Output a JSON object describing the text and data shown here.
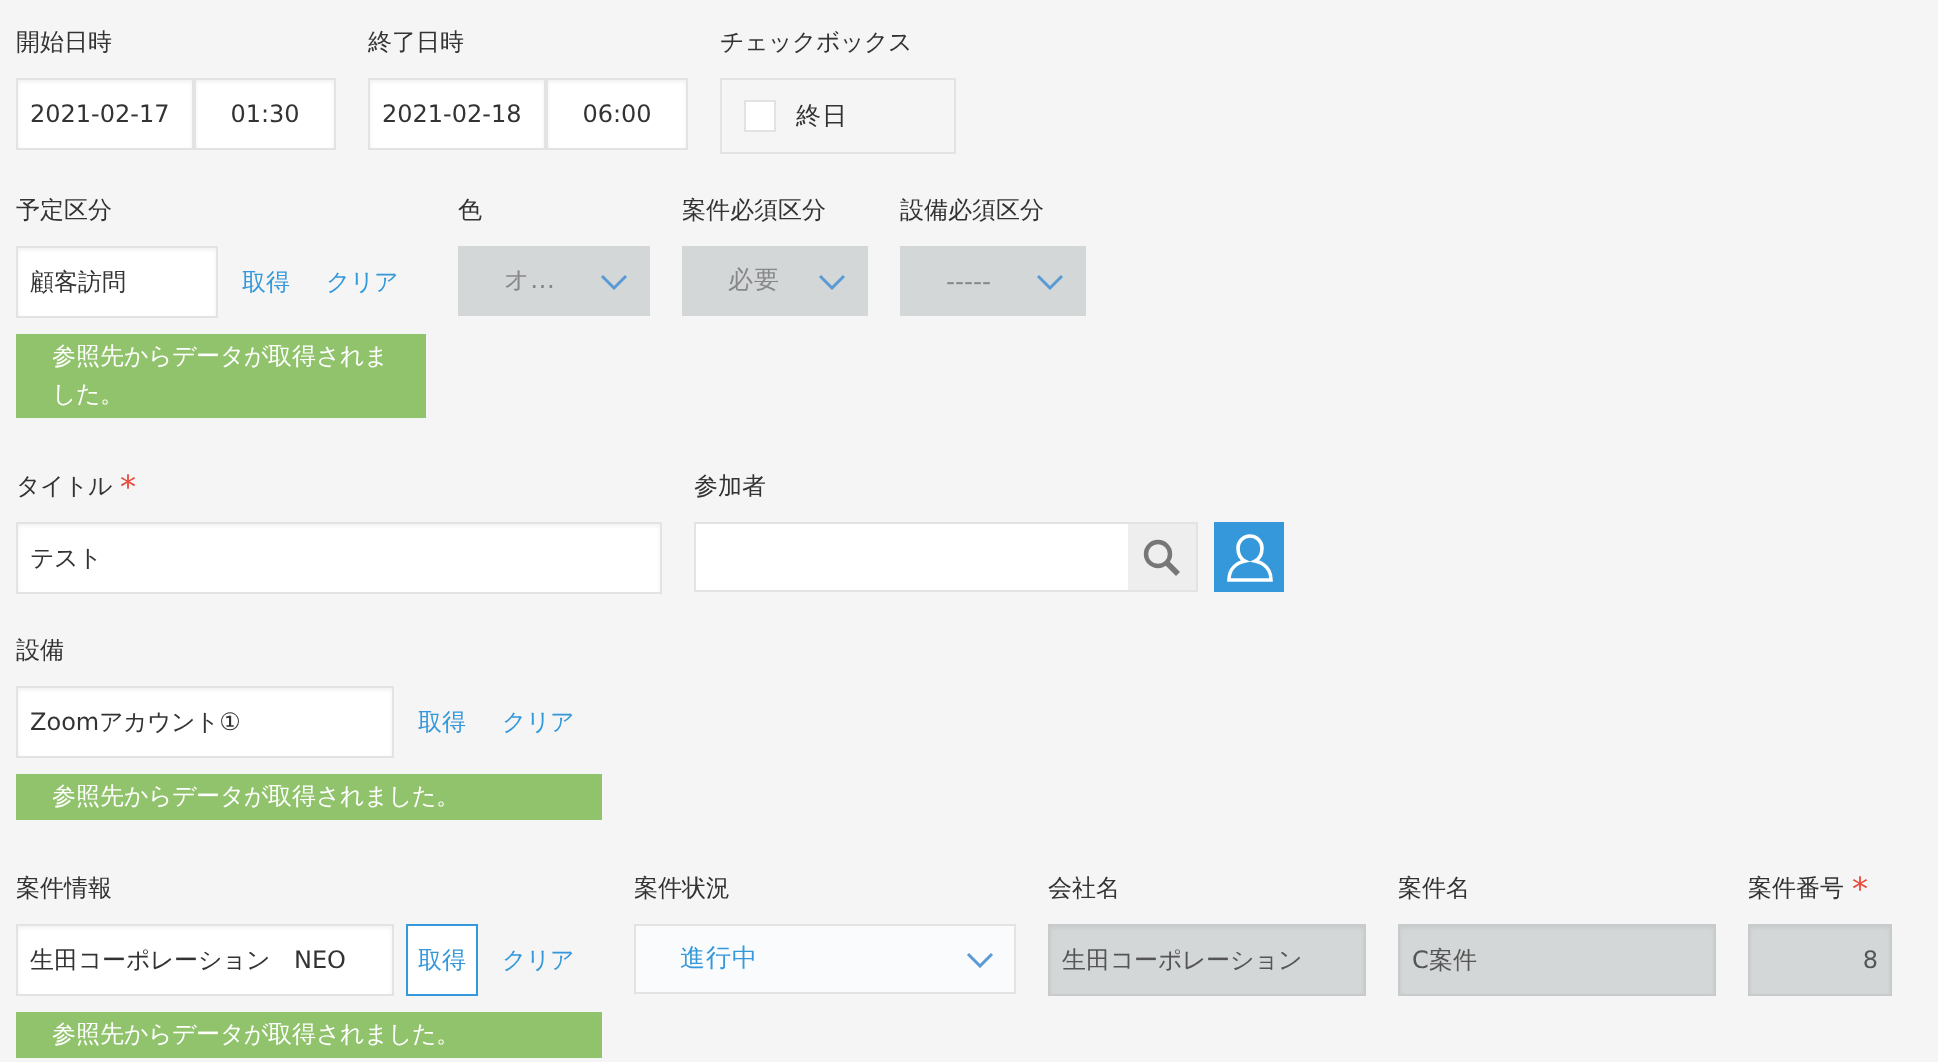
{
  "rows": [
    {
      "fields": [
        {
          "kind": "datetime",
          "label": "開始日時",
          "date": "2021-02-17",
          "time": "01:30"
        },
        {
          "kind": "datetime",
          "label": "終了日時",
          "date": "2021-02-18",
          "time": "06:00"
        },
        {
          "kind": "checkbox",
          "label": "チェックボックス",
          "options": [
            {
              "label": "終日",
              "checked": false
            }
          ]
        }
      ]
    },
    {
      "fields": [
        {
          "kind": "lookup",
          "label": "予定区分",
          "value": "顧客訪問",
          "get": "取得",
          "get_focused": false,
          "clear": "クリア",
          "message": "参照先からデータが取得されました。"
        },
        {
          "kind": "select",
          "label": "色",
          "value": "オ…",
          "disabled": true
        },
        {
          "kind": "select",
          "label": "案件必須区分",
          "value": "必要",
          "disabled": true
        },
        {
          "kind": "select",
          "label": "設備必須区分",
          "value": "-----",
          "disabled": true
        }
      ]
    },
    {
      "fields": [
        {
          "kind": "text",
          "label": "タイトル",
          "required_mark": "*",
          "value": "テスト",
          "disabled": false
        },
        {
          "kind": "user",
          "label": "参加者"
        }
      ]
    },
    {
      "fields": [
        {
          "kind": "lookup",
          "label": "設備",
          "value": "Zoomアカウント①",
          "get": "取得",
          "get_focused": false,
          "clear": "クリア",
          "message": "参照先からデータが取得されました。"
        }
      ]
    },
    {
      "fields": [
        {
          "kind": "lookup",
          "label": "案件情報",
          "value": "生田コーポレーション　NEO",
          "get": "取得",
          "get_focused": true,
          "clear": "クリア",
          "message": "参照先からデータが取得されました。"
        },
        {
          "kind": "select",
          "label": "案件状況",
          "value": "進行中",
          "disabled": false
        },
        {
          "kind": "text",
          "label": "会社名",
          "value": "生田コーポレーション",
          "disabled": true
        },
        {
          "kind": "text",
          "label": "案件名",
          "value": "C案件",
          "disabled": true
        },
        {
          "kind": "number",
          "label": "案件番号",
          "required_mark": "*",
          "value": "8",
          "disabled": true
        }
      ]
    }
  ]
}
